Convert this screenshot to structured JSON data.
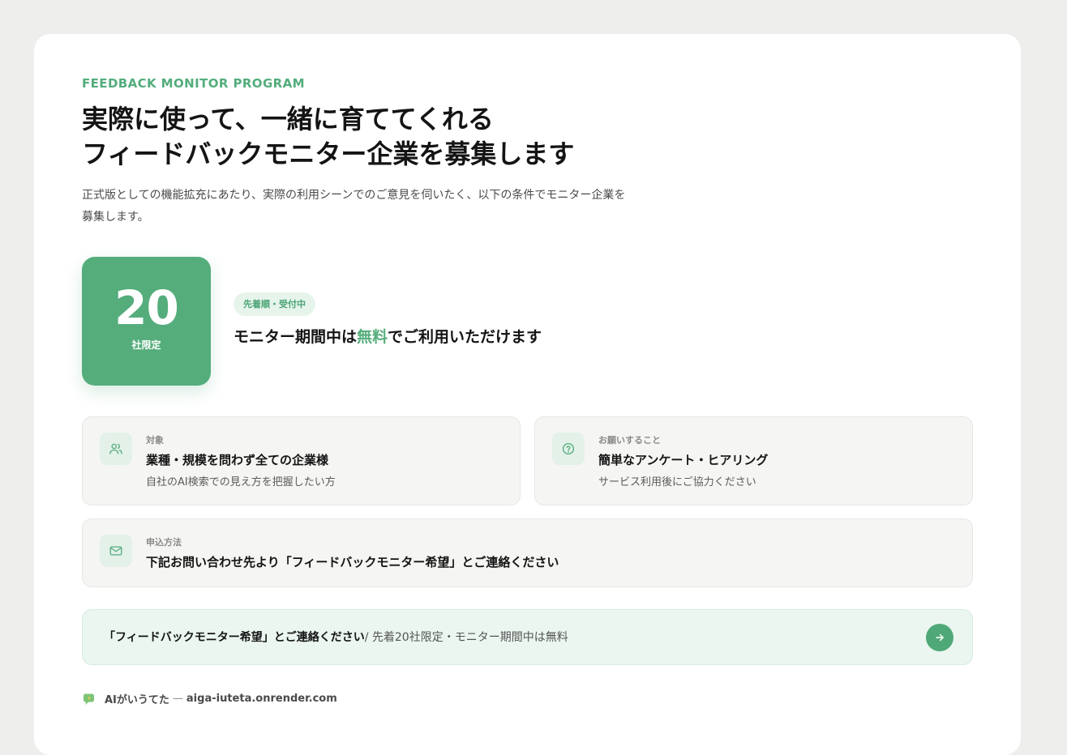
{
  "header": {
    "eyebrow": "FEEDBACK MONITOR PROGRAM",
    "title_line1": "実際に使って、一緒に育ててくれる",
    "title_line2": "フィードバックモニター企業を募集します",
    "lead_line1": "正式版としての機能拡充にあたり、実際の利用シーンでのご意見を伺いたく、以下の条件でモニター企業を",
    "lead_line2": "募集します。"
  },
  "limit_badge": {
    "number": "20",
    "caption": "社限定"
  },
  "status_pill": "先着順・受付中",
  "offer": {
    "prefix": "モニター期間中は",
    "highlight": "無料",
    "suffix": "でご利用いただけます"
  },
  "info_cards": [
    {
      "label": "対象",
      "main": "業種・規模を問わず全ての企業様",
      "sub": "自社のAI検索での見え方を把握したい方",
      "icon": "users-icon"
    },
    {
      "label": "お願いすること",
      "main": "簡単なアンケート・ヒアリング",
      "sub": "サービス利用後にご協力ください",
      "icon": "question-icon"
    },
    {
      "label": "申込方法",
      "main": "下記お問い合わせ先より「フィードバックモニター希望」とご連絡ください",
      "icon": "mail-icon"
    }
  ],
  "cta": {
    "strong": "「フィードバックモニター希望」とご連絡ください",
    "rest": "/ 先着20社限定・モニター期間中は無料",
    "icon": "arrow-right-icon"
  },
  "footer": {
    "brand": "AIがいうてた",
    "separator": "—",
    "url": "aiga-iuteta.onrender.com",
    "icon": "chat-logo-icon"
  },
  "colors": {
    "accent": "#55ad7c",
    "accent_light": "#e6f4ec",
    "page_bg": "#eeeeec",
    "card_bg": "#ffffff",
    "info_bg": "#f5f5f3",
    "cta_bg": "#eaf6ef"
  }
}
